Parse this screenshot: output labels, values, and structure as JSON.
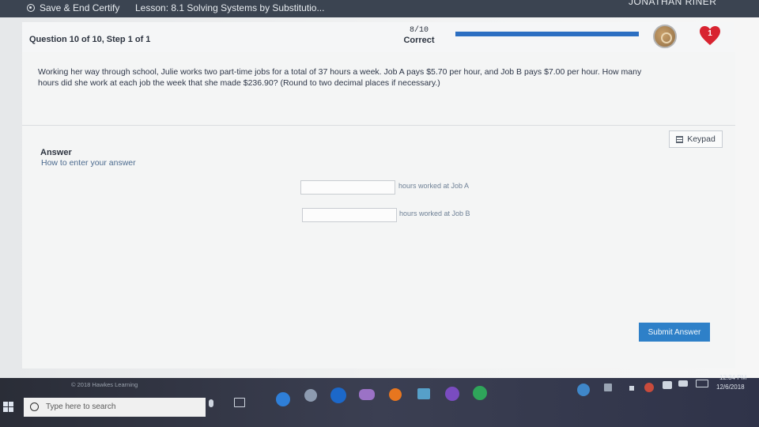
{
  "topbar": {
    "save_label": "Save & End Certify",
    "lesson": "Lesson: 8.1 Solving Systems by Substitutio...",
    "user": "JONATHAN RINER"
  },
  "question": {
    "title": "Question 10 of 10, Step 1 of 1",
    "score": "8/10",
    "score_label": "Correct",
    "progress_fraction": 1.0,
    "hearts": "1",
    "text_line1": "Working her way through school, Julie works two part-time jobs for a total of 37 hours a week. Job A pays $5.70 per hour, and Job B pays $7.00 per hour. How many",
    "text_line2": "hours did she work at each job the week that she made $236.90? (Round to two decimal places if necessary.)"
  },
  "answer": {
    "keypad_label": "Keypad",
    "heading": "Answer",
    "howto": "How to enter your answer",
    "job_a_label": "hours worked at Job A",
    "job_b_label": "hours worked at Job B",
    "job_a_value": "",
    "job_b_value": "",
    "submit_label": "Submit Answer"
  },
  "footer": {
    "copyright": "© 2018 Hawkes Learning"
  },
  "taskbar": {
    "search_placeholder": "Type here to search",
    "time": "12:34 PM",
    "date": "12/6/2018"
  },
  "colors": {
    "accent": "#2e80c8",
    "heart": "#d82330",
    "topbar": "#3b4451"
  }
}
